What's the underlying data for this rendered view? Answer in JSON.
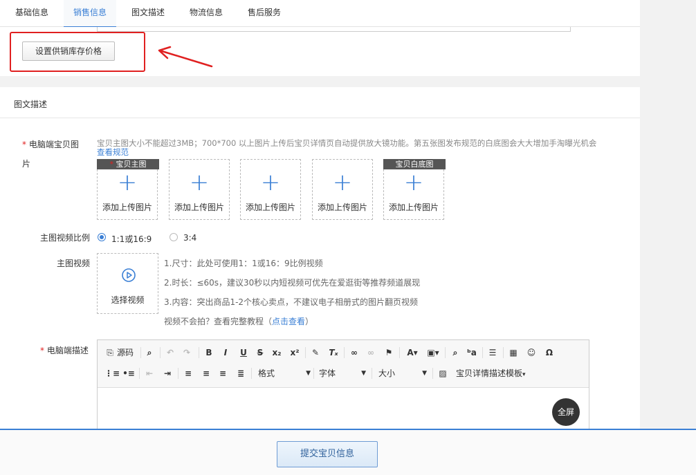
{
  "tabs": [
    {
      "label": "基础信息"
    },
    {
      "label": "销售信息"
    },
    {
      "label": "图文描述"
    },
    {
      "label": "物流信息"
    },
    {
      "label": "售后服务"
    }
  ],
  "supply_button": "设置供销库存价格",
  "section_title": "图文描述",
  "main_image": {
    "required_mark": "*",
    "label_line1": "电脑端宝贝图",
    "label_line2": "片",
    "hint": "宝贝主图大小不能超过3MB；700*700 以上图片上传后宝贝详情页自动提供放大镜功能。第五张图发布规范的白底图会大大增加手淘曝光机会",
    "spec_link": "查看规范",
    "slots": [
      {
        "caption_mark": "*",
        "caption": "宝贝主图",
        "text": "添加上传图片"
      },
      {
        "text": "添加上传图片"
      },
      {
        "text": "添加上传图片"
      },
      {
        "text": "添加上传图片"
      },
      {
        "caption": "宝贝白底图",
        "text": "添加上传图片"
      }
    ]
  },
  "video_ratio": {
    "label": "主图视频比例",
    "options": [
      "1:1或16:9",
      "3:4"
    ],
    "selected": "1:1或16:9"
  },
  "video": {
    "label": "主图视频",
    "select_text": "选择视频",
    "notes": [
      "1.尺寸：此处可使用1：1或16：9比例视频",
      "2.时长：≤60s，建议30秒以内短视频可优先在爱逛街等推荐频道展现",
      "3.内容：突出商品1-2个核心卖点，不建议电子相册式的图片翻页视频"
    ],
    "tutorial_prefix": "视频不会拍？查看完整教程（",
    "tutorial_link": "点击查看",
    "tutorial_suffix": "）"
  },
  "desc": {
    "required_mark": "*",
    "label": "电脑端描述",
    "toolbar": {
      "source": "源码",
      "format": "格式",
      "font": "字体",
      "size": "大小",
      "template": "宝贝详情描述模板"
    },
    "fullscreen": "全屏"
  },
  "submit": "提交宝贝信息",
  "colors": {
    "accent": "#3a7fd5",
    "highlight": "#e02020"
  }
}
